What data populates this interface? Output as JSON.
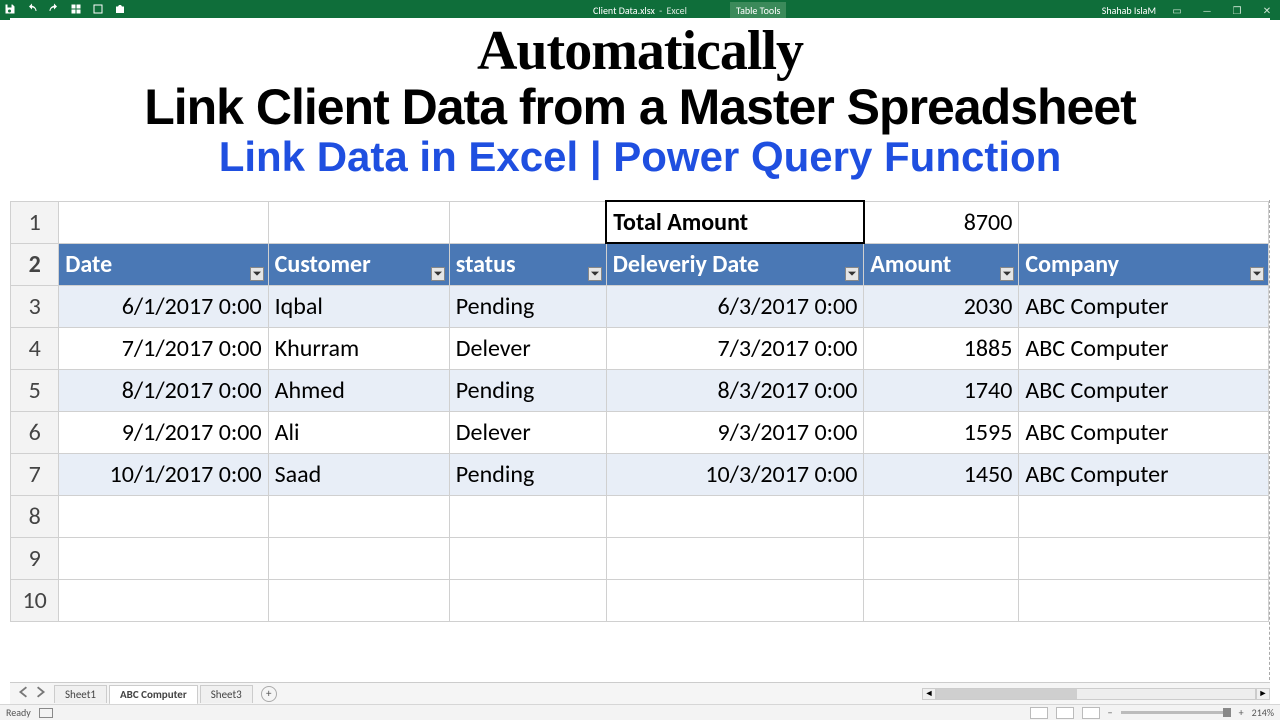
{
  "titlebar": {
    "filename": "Client Data.xlsx",
    "app": "Excel",
    "contextTab": "Table Tools",
    "user": "Shahab IslaM"
  },
  "overlay": {
    "line1": "Automatically",
    "line2": "Link Client Data from a Master Spreadsheet",
    "line3": "Link Data in Excel   | Power Query Function"
  },
  "sheet": {
    "totalLabel": "Total Amount",
    "totalValue": "8700",
    "headers": [
      "Date",
      "Customer",
      "status",
      "Deleveriy Date",
      "Amount",
      "Company"
    ],
    "rows": [
      {
        "date": "6/1/2017 0:00",
        "customer": "Iqbal",
        "status": "Pending",
        "delivery": "6/3/2017 0:00",
        "amount": "2030",
        "company": "ABC Computer"
      },
      {
        "date": "7/1/2017 0:00",
        "customer": "Khurram",
        "status": "Delever",
        "delivery": "7/3/2017 0:00",
        "amount": "1885",
        "company": "ABC Computer"
      },
      {
        "date": "8/1/2017 0:00",
        "customer": "Ahmed",
        "status": "Pending",
        "delivery": "8/3/2017 0:00",
        "amount": "1740",
        "company": "ABC Computer"
      },
      {
        "date": "9/1/2017 0:00",
        "customer": "Ali",
        "status": "Delever",
        "delivery": "9/3/2017 0:00",
        "amount": "1595",
        "company": "ABC Computer"
      },
      {
        "date": "10/1/2017 0:00",
        "customer": "Saad",
        "status": "Pending",
        "delivery": "10/3/2017 0:00",
        "amount": "1450",
        "company": "ABC Computer"
      }
    ],
    "emptyRows": [
      "8",
      "9",
      "10"
    ]
  },
  "tabs": {
    "list": [
      "Sheet1",
      "ABC Computer",
      "Sheet3"
    ],
    "activeIndex": 1
  },
  "status": {
    "ready": "Ready",
    "zoom": "214%"
  }
}
